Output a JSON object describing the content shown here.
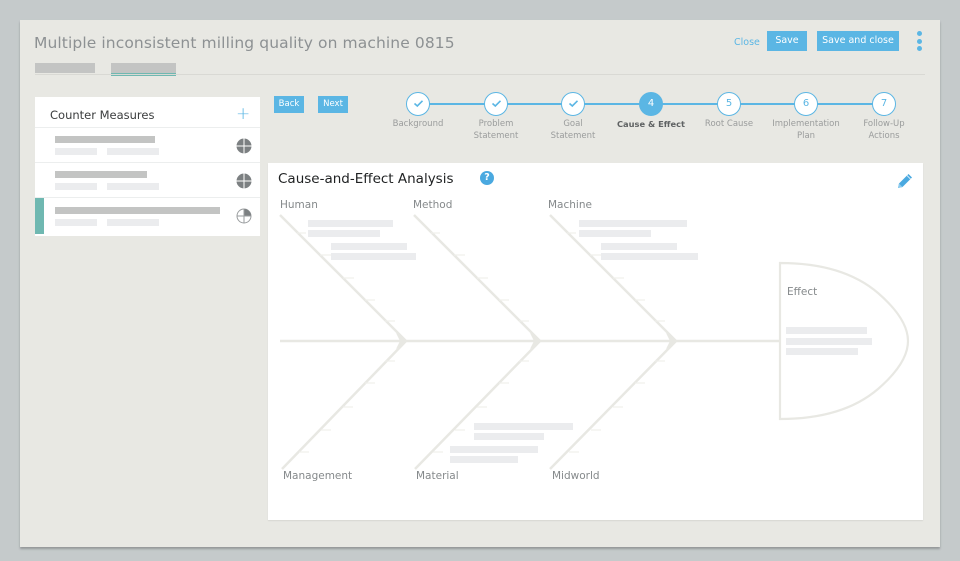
{
  "header": {
    "title": "Multiple inconsistent milling quality on machine 0815",
    "tabs": [
      {
        "label": "",
        "active": false
      },
      {
        "label": "",
        "active": true
      }
    ],
    "close_label": "Close",
    "save_label": "Save",
    "save_close_label": "Save and close",
    "menu_icon": "kebab-vertical-icon",
    "accent_color": "#5bb6e4"
  },
  "counter_measures": {
    "title": "Counter Measures",
    "add_icon": "plus-icon",
    "items": [
      {
        "status_icon": "progress-full-icon",
        "progress": 1.0,
        "selected": false
      },
      {
        "status_icon": "progress-full-icon",
        "progress": 1.0,
        "selected": false
      },
      {
        "status_icon": "progress-quarter-icon",
        "progress": 0.25,
        "selected": true
      }
    ],
    "selected_color": "#6fb8b1"
  },
  "navigation": {
    "back_label": "Back",
    "next_label": "Next"
  },
  "stepper": {
    "current": 4,
    "steps": [
      {
        "number": "1",
        "label": "Background",
        "done": true
      },
      {
        "number": "2",
        "label": "Problem Statement",
        "done": true
      },
      {
        "number": "3",
        "label": "Goal Statement",
        "done": true
      },
      {
        "number": "4",
        "label": "Cause & Effect",
        "done": false,
        "current": true
      },
      {
        "number": "5",
        "label": "Root Cause",
        "done": false
      },
      {
        "number": "6",
        "label": "Implementation Plan",
        "done": false
      },
      {
        "number": "7",
        "label": "Follow-Up Actions",
        "done": false
      }
    ]
  },
  "analysis": {
    "title": "Cause-and-Effect Analysis",
    "help_icon": "question-icon",
    "edit_icon": "pencil-icon",
    "categories_top": [
      "Human",
      "Method",
      "Machine"
    ],
    "categories_bottom": [
      "Management",
      "Material",
      "Midworld"
    ],
    "effect_label": "Effect"
  }
}
